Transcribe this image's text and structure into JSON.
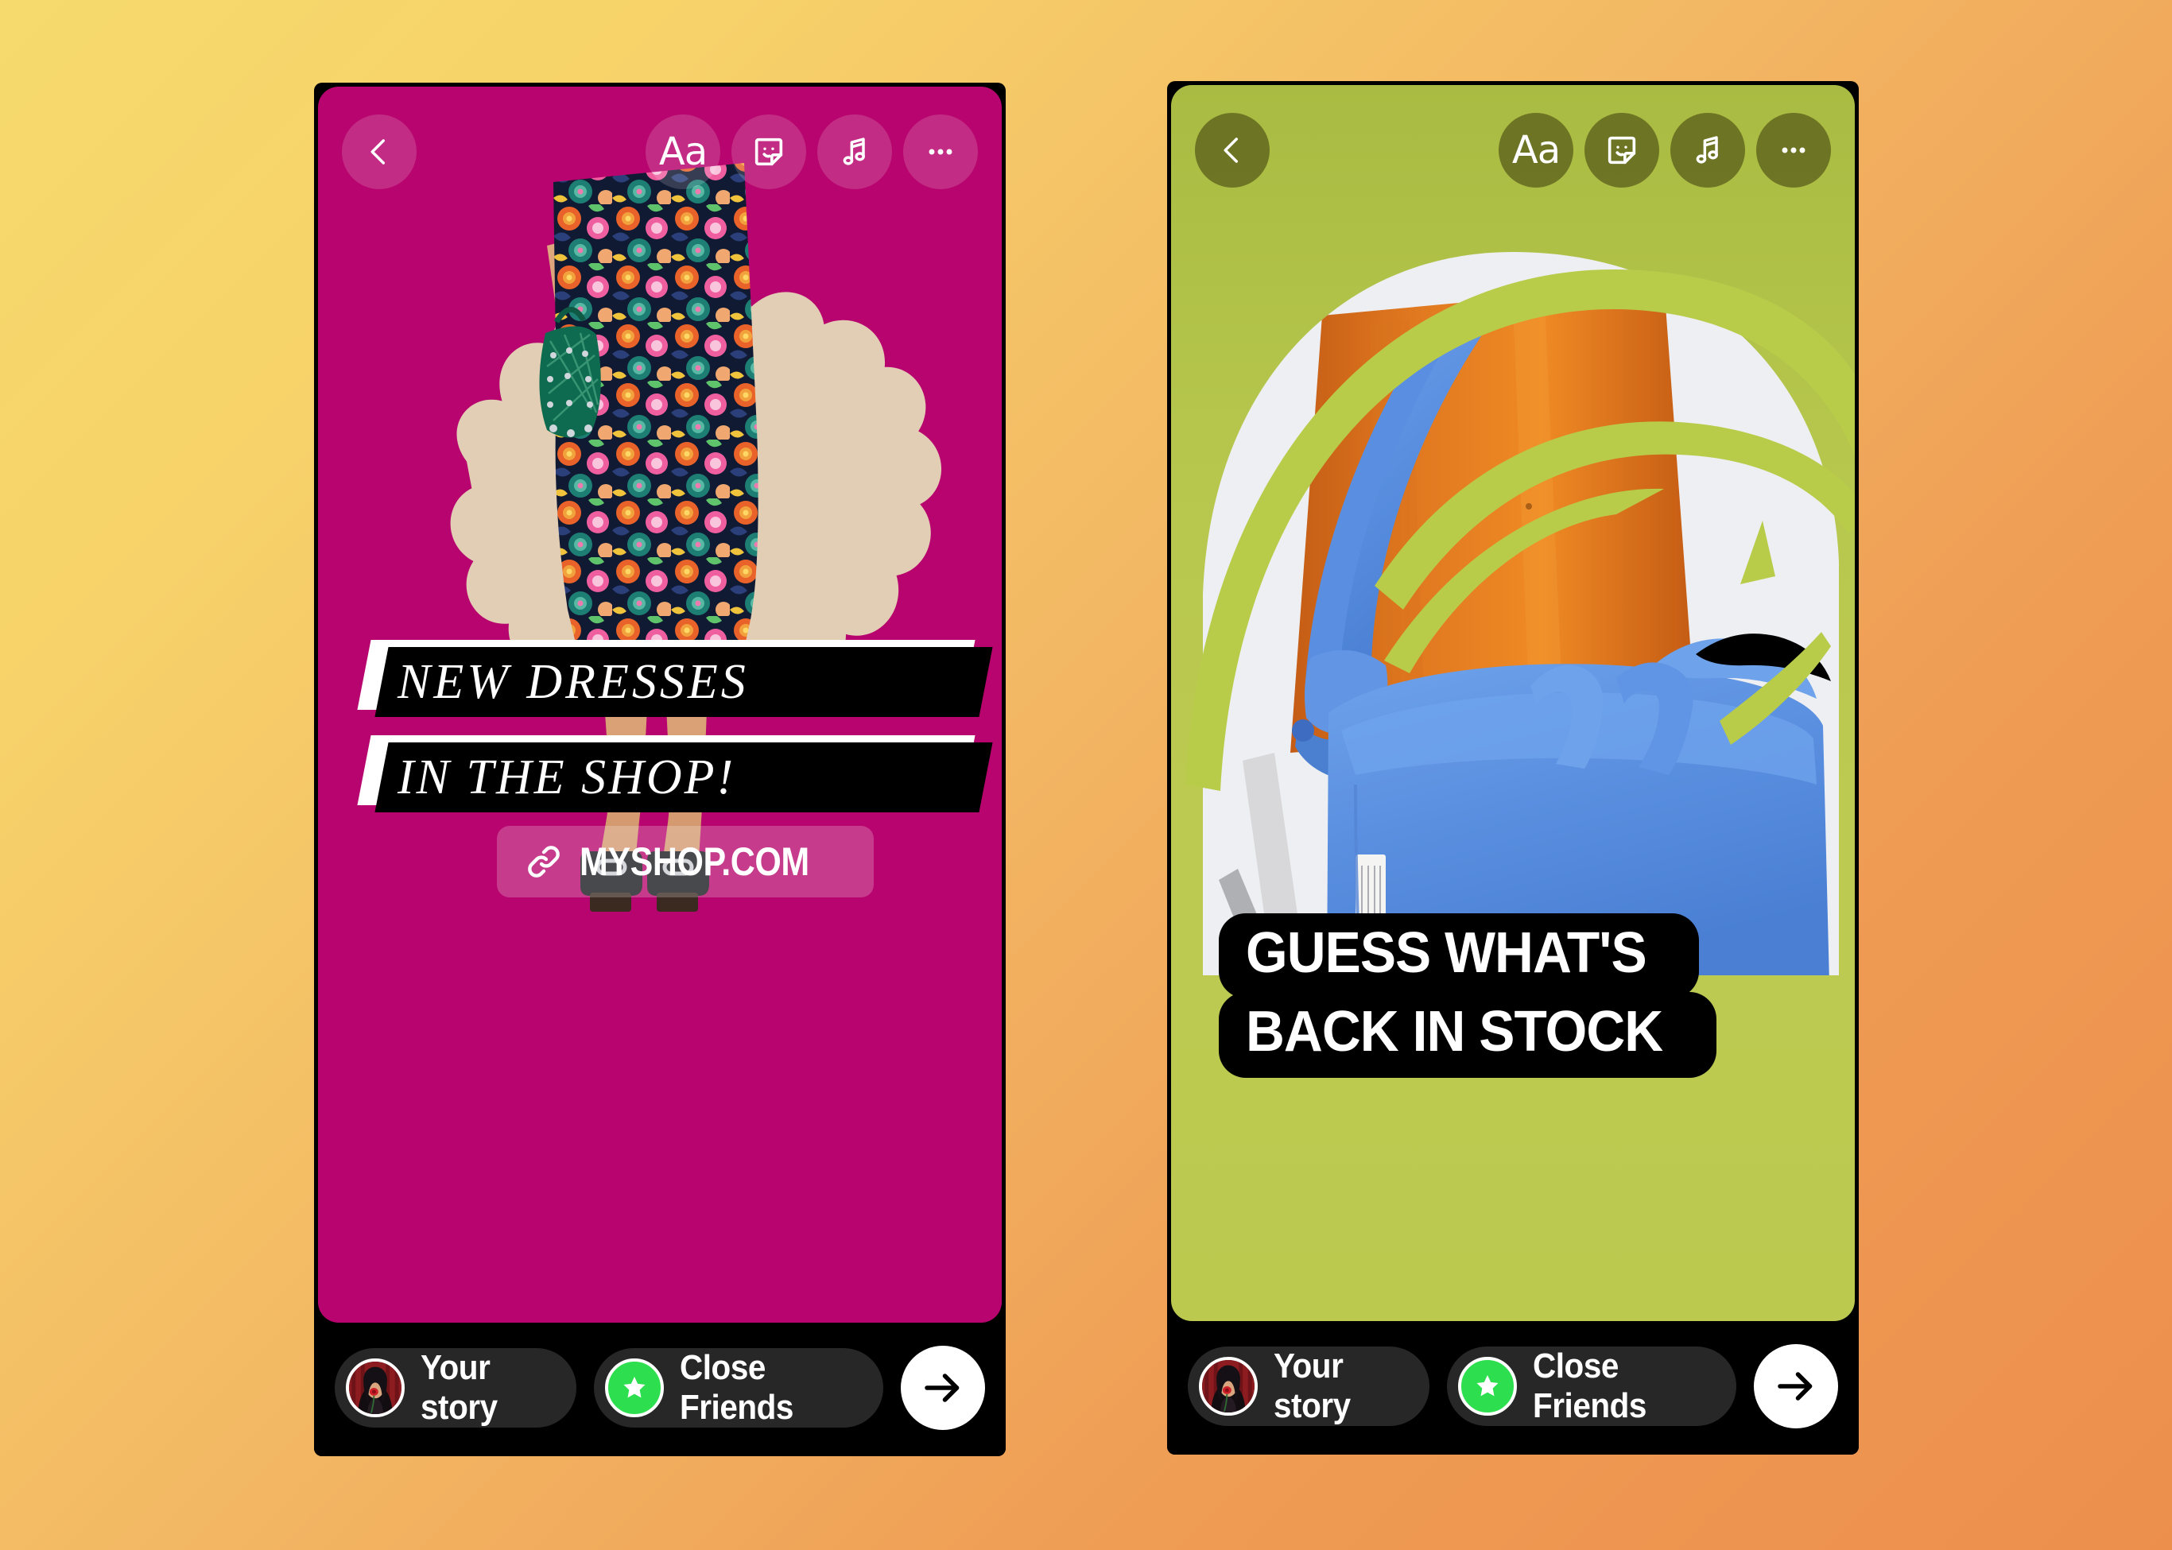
{
  "background": {
    "gradient_from": "#f6da6d",
    "gradient_to": "#ec8f4d"
  },
  "toolbar": {
    "back_label": "Back",
    "text_tool_label": "Aa",
    "sticker_tool_label": "Sticker",
    "music_tool_label": "Music",
    "more_tool_label": "More options"
  },
  "stories": [
    {
      "name": "new-dresses-story",
      "canvas_color": "#b8046e",
      "theme": "magenta",
      "artwork_description": "Woman in floral print dress holding green beaded handbag on beige scalloped brush shape",
      "text_lines": [
        "NEW DRESSES",
        "IN THE SHOP!"
      ],
      "link_sticker": {
        "label": "MYSHOP.COM",
        "icon": "link-icon"
      }
    },
    {
      "name": "back-in-stock-story",
      "canvas_color": "#bcc94f",
      "theme": "green",
      "artwork_description": "Blue puffy tote bag on orange wooden chair with lime green swoosh arcs",
      "text_lines": [
        "GUESS WHAT'S",
        "BACK IN STOCK"
      ],
      "accent_color": "#b9cc4a"
    }
  ],
  "bottom_bar": {
    "your_story_label": "Your story",
    "close_friends_label": "Close Friends",
    "send_label": "Send",
    "close_friends_color": "#2ddf4f",
    "avatar_alt": "Your profile photo"
  }
}
